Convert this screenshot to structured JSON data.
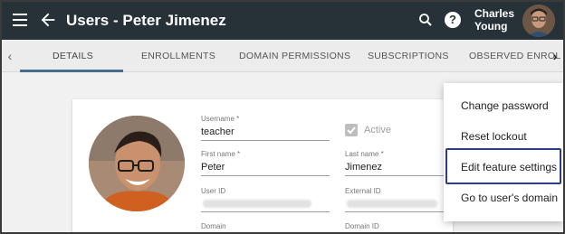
{
  "appbar": {
    "title": "Users - Peter Jimenez",
    "user_first": "Charles",
    "user_last": "Young"
  },
  "tabs": [
    {
      "label": "DETAILS",
      "active": true
    },
    {
      "label": "ENROLLMENTS"
    },
    {
      "label": "DOMAIN PERMISSIONS"
    },
    {
      "label": "SUBSCRIPTIONS"
    },
    {
      "label": "OBSERVED ENROL"
    }
  ],
  "form": {
    "username_label": "Username *",
    "username_value": "teacher",
    "active_label": "Active",
    "active_checked": true,
    "first_name_label": "First name *",
    "first_name_value": "Peter",
    "last_name_label": "Last name *",
    "last_name_value": "Jimenez",
    "user_id_label": "User ID",
    "external_id_label": "External ID",
    "domain_label": "Domain",
    "domain_id_label": "Domain ID"
  },
  "menu": {
    "items": [
      {
        "label": "Change password"
      },
      {
        "label": "Reset lockout"
      },
      {
        "label": "Edit feature settings",
        "highlighted": true
      },
      {
        "label": "Go to user's domain"
      }
    ]
  },
  "colors": {
    "appbar": "#263238",
    "tab_underline": "#4a6d8c",
    "highlight_border": "#2b3e8c"
  }
}
